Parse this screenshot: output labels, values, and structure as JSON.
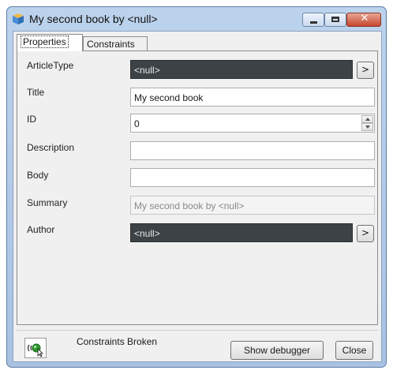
{
  "window": {
    "title": "My second book by <null>",
    "controls": {
      "minimize": "minimize",
      "maximize": "maximize",
      "close": "✕"
    }
  },
  "tabs": [
    {
      "label": "Properties",
      "active": true
    },
    {
      "label": "Constraints",
      "active": false
    }
  ],
  "fields": {
    "article_type": {
      "label": "ArticleType",
      "value": "<null>",
      "button": ">"
    },
    "title": {
      "label": "Title",
      "value": "My second book"
    },
    "id": {
      "label": "ID",
      "value": "0"
    },
    "description": {
      "label": "Description",
      "value": ""
    },
    "body": {
      "label": "Body",
      "value": ""
    },
    "summary": {
      "label": "Summary",
      "value": "My second book by <null>"
    },
    "author": {
      "label": "Author",
      "value": "<null>",
      "button": ">"
    }
  },
  "footer": {
    "status": "Constraints Broken",
    "show_debugger": "Show debugger",
    "close": "Close"
  },
  "colors": {
    "dark_field": "#3c4245",
    "title_bar": "#bcd3ec",
    "close_button": "#c7472f"
  }
}
